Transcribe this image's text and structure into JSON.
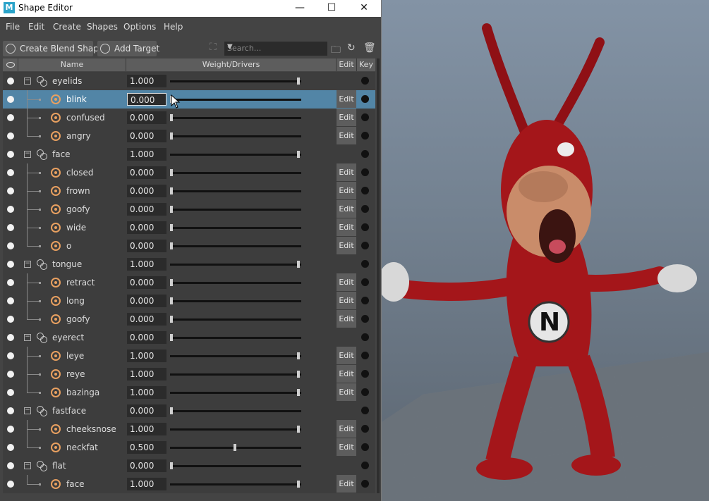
{
  "window": {
    "title": "Shape Editor",
    "app_icon_letter": "M",
    "controls": {
      "minimize": "—",
      "maximize": "☐",
      "close": "✕"
    }
  },
  "menu": [
    "File",
    "Edit",
    "Create",
    "Shapes",
    "Options",
    "Help"
  ],
  "toolbar": {
    "create_blend_shape": "Create Blend Shape",
    "add_target": "Add Target",
    "search_placeholder": "Search...",
    "icons": [
      "select-icon",
      "new-folder-icon",
      "refresh-icon",
      "delete-icon"
    ]
  },
  "columns": {
    "name": "Name",
    "weight": "Weight/Drivers",
    "edit": "Edit",
    "key": "Key"
  },
  "edit_label": "Edit",
  "rows": [
    {
      "type": "group",
      "name": "eyelids",
      "weight": "1.000",
      "value": 1.0,
      "edit": false
    },
    {
      "type": "target",
      "name": "blink",
      "weight": "0.000",
      "value": 0.0,
      "edit": true,
      "selected": true
    },
    {
      "type": "target",
      "name": "confused",
      "weight": "0.000",
      "value": 0.0,
      "edit": true
    },
    {
      "type": "target",
      "name": "angry",
      "weight": "0.000",
      "value": 0.0,
      "edit": true,
      "last": true
    },
    {
      "type": "group",
      "name": "face",
      "weight": "1.000",
      "value": 1.0,
      "edit": false
    },
    {
      "type": "target",
      "name": "closed",
      "weight": "0.000",
      "value": 0.0,
      "edit": true
    },
    {
      "type": "target",
      "name": "frown",
      "weight": "0.000",
      "value": 0.0,
      "edit": true
    },
    {
      "type": "target",
      "name": "goofy",
      "weight": "0.000",
      "value": 0.0,
      "edit": true
    },
    {
      "type": "target",
      "name": "wide",
      "weight": "0.000",
      "value": 0.0,
      "edit": true
    },
    {
      "type": "target",
      "name": "o",
      "weight": "0.000",
      "value": 0.0,
      "edit": true,
      "last": true
    },
    {
      "type": "group",
      "name": "tongue",
      "weight": "1.000",
      "value": 1.0,
      "edit": false
    },
    {
      "type": "target",
      "name": "retract",
      "weight": "0.000",
      "value": 0.0,
      "edit": true
    },
    {
      "type": "target",
      "name": "long",
      "weight": "0.000",
      "value": 0.0,
      "edit": true
    },
    {
      "type": "target",
      "name": "goofy",
      "weight": "0.000",
      "value": 0.0,
      "edit": true,
      "last": true
    },
    {
      "type": "group",
      "name": "eyerect",
      "weight": "0.000",
      "value": 0.0,
      "edit": false
    },
    {
      "type": "target",
      "name": "leye",
      "weight": "1.000",
      "value": 1.0,
      "edit": true
    },
    {
      "type": "target",
      "name": "reye",
      "weight": "1.000",
      "value": 1.0,
      "edit": true
    },
    {
      "type": "target",
      "name": "bazinga",
      "weight": "1.000",
      "value": 1.0,
      "edit": true,
      "last": true
    },
    {
      "type": "group",
      "name": "fastface",
      "weight": "0.000",
      "value": 0.0,
      "edit": false
    },
    {
      "type": "target",
      "name": "cheeksnose",
      "weight": "1.000",
      "value": 1.0,
      "edit": true
    },
    {
      "type": "target",
      "name": "neckfat",
      "weight": "0.500",
      "value": 0.5,
      "edit": true,
      "last": true
    },
    {
      "type": "group",
      "name": "flat",
      "weight": "0.000",
      "value": 0.0,
      "edit": false
    },
    {
      "type": "target",
      "name": "face",
      "weight": "1.000",
      "value": 1.0,
      "edit": true,
      "last": true
    }
  ],
  "viewport": {
    "chest_letter": "N"
  },
  "colors": {
    "selection": "#5285a6",
    "panel": "#444444",
    "character": "#a4161a"
  }
}
